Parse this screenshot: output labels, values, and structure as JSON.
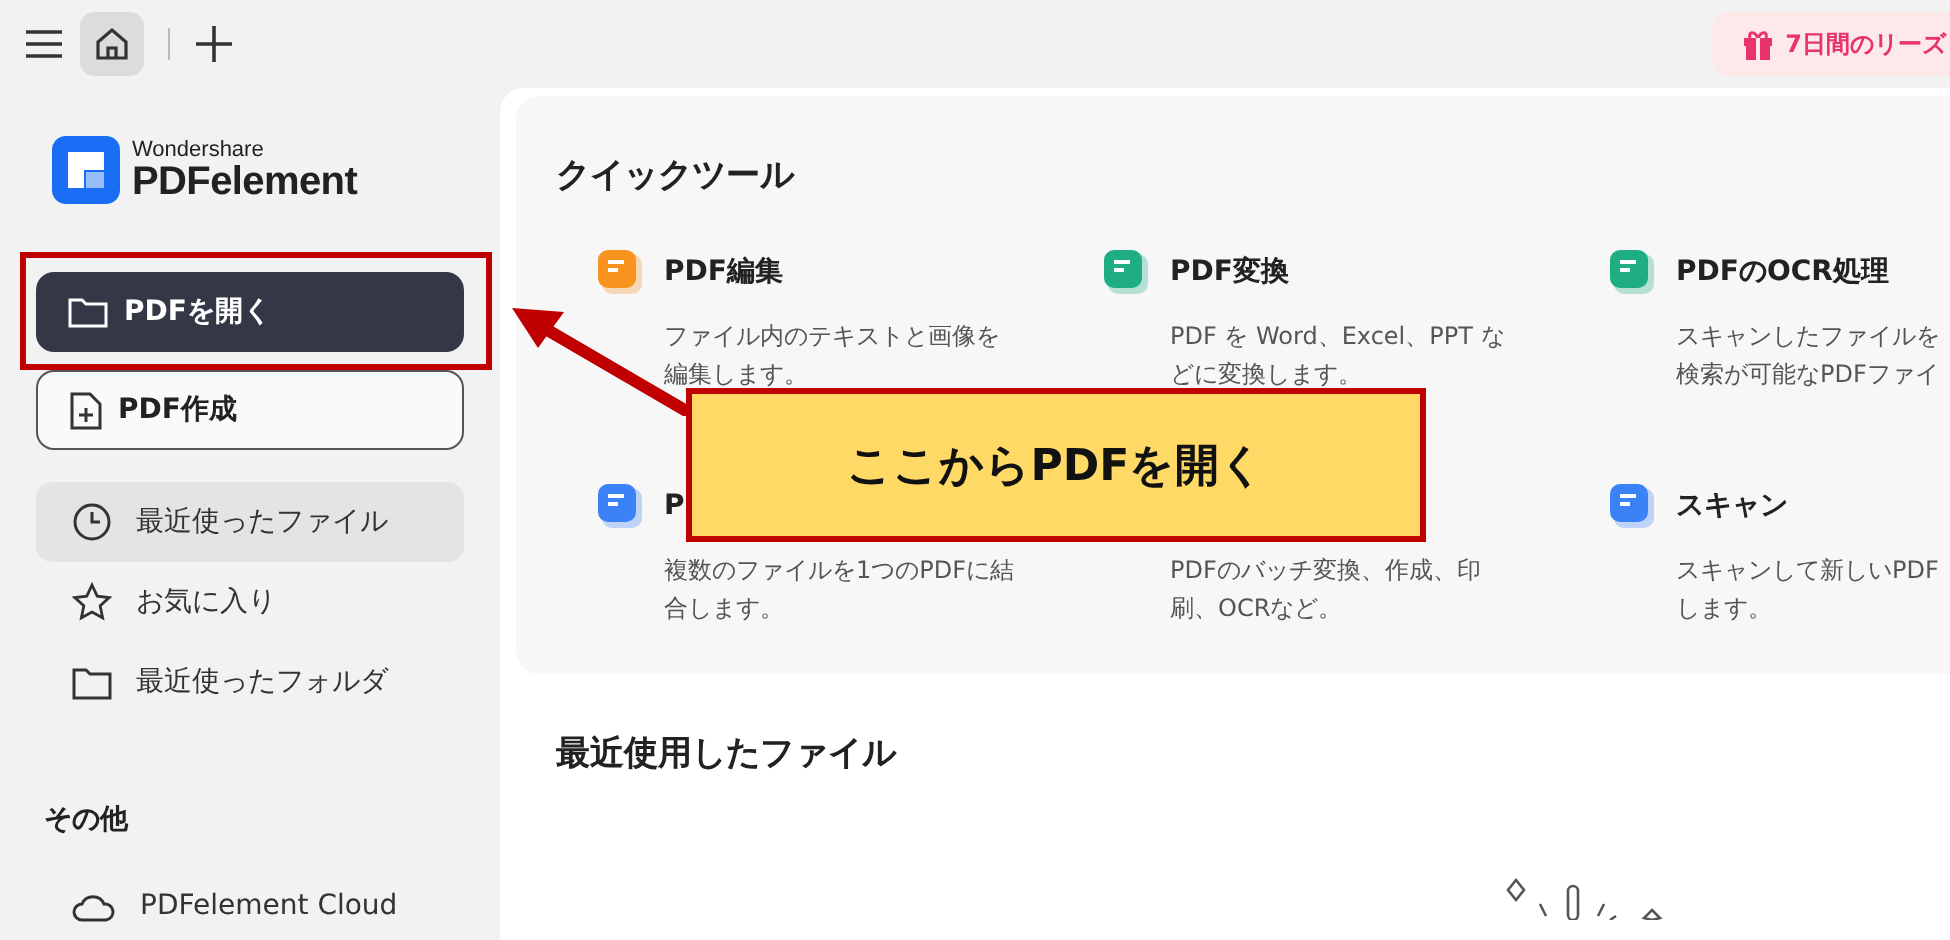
{
  "top_bar": {
    "home_selected": true,
    "promo": "7日間のリーズ"
  },
  "sidebar": {
    "logo_brand": "Wondershare",
    "logo_product": "PDFelement",
    "actions": [
      {
        "label": "PDFを開く",
        "kind": "primary"
      },
      {
        "label": "PDF作成",
        "kind": "outline"
      }
    ],
    "nav": [
      {
        "label": "最近使ったファイル",
        "kind": "clock",
        "selected": true
      },
      {
        "label": "お気に入り",
        "kind": "star",
        "selected": false
      },
      {
        "label": "最近使ったフォルダ",
        "kind": "folder",
        "selected": false
      }
    ],
    "other_heading": "その他",
    "other": [
      {
        "label": "PDFelement Cloud",
        "kind": "cloud"
      }
    ]
  },
  "quick_tools": {
    "title": "クイックツール",
    "tools": [
      {
        "kind": "edit",
        "title": "PDF編集",
        "desc": [
          "ファイル内のテキストと画像を",
          "編集します。"
        ]
      },
      {
        "kind": "convert",
        "title": "PDF変換",
        "desc": [
          "PDF を Word、Excel、PPT な",
          "どに変換します。"
        ]
      },
      {
        "kind": "ocr",
        "title": "PDFのOCR処理",
        "desc": [
          "スキャンしたファイルを",
          "検索が可能なPDFファイ"
        ]
      },
      {
        "kind": "combine",
        "title": "P",
        "desc": [
          "複数のファイルを1つのPDFに結",
          "合します。"
        ]
      },
      {
        "desc": [
          "PDFのバッチ変換、作成、印",
          "刷、OCRなど。"
        ]
      },
      {
        "kind": "scan",
        "title": "スキャン",
        "desc": [
          "スキャンして新しいPDF",
          "します。"
        ]
      }
    ]
  },
  "recent": {
    "title": "最近使用したファイル"
  },
  "callout": {
    "text": "ここからPDFを開く"
  }
}
